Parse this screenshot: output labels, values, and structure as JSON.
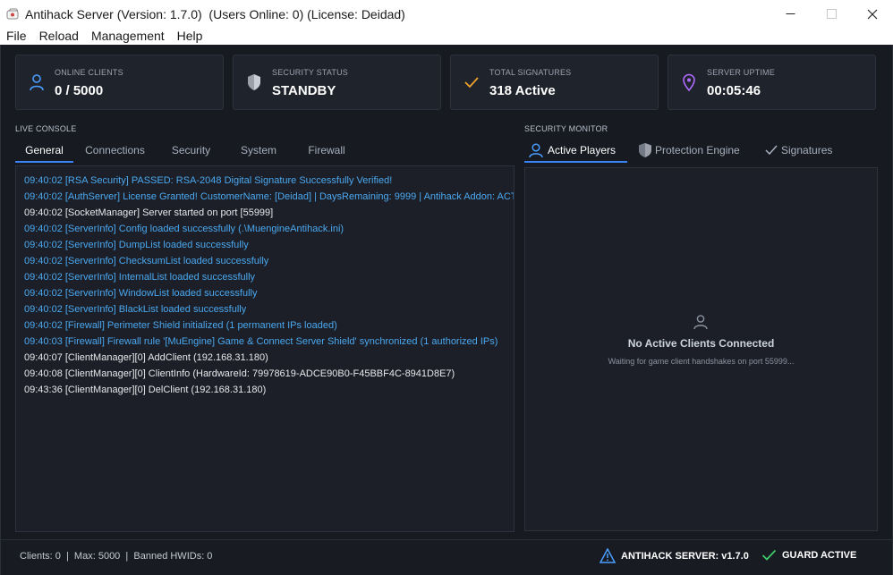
{
  "window": {
    "title": "Antihack Server (Version: 1.7.0)  (Users Online: 0) (License: Deidad)",
    "app_icon": "app-icon",
    "controls": [
      "minimize-icon",
      "maximize-icon",
      "close-icon"
    ]
  },
  "menu": {
    "items": [
      "File",
      "Reload",
      "Management",
      "Help"
    ]
  },
  "cards": [
    {
      "label": "ONLINE CLIENTS",
      "value": "0 / 5000",
      "icon": "user-icon",
      "color": "#4a9eff"
    },
    {
      "label": "SECURITY STATUS",
      "value": "STANDBY",
      "icon": "shield-icon",
      "color": "#c9ced6"
    },
    {
      "label": "TOTAL SIGNATURES",
      "value": "318 Active",
      "icon": "check-icon",
      "color": "#f0a030"
    },
    {
      "label": "SERVER UPTIME",
      "value": "00:05:46",
      "icon": "location-pin-icon",
      "color": "#b06cff"
    }
  ],
  "console": {
    "label": "LIVE CONSOLE",
    "tabs": [
      "General",
      "Connections",
      "Security",
      "System",
      "Firewall"
    ],
    "active_tab": "General",
    "lines": [
      {
        "text": "09:40:02 [RSA Security] PASSED: RSA-2048 Digital Signature Successfully Verified!",
        "kind": "info"
      },
      {
        "text": "09:40:02 [AuthServer] License Granted! CustomerName: [Deidad] | DaysRemaining: 9999 | Antihack Addon: ACT",
        "kind": "info"
      },
      {
        "text": "09:40:02 [SocketManager] Server started on port [55999]",
        "kind": "plain"
      },
      {
        "text": "09:40:02 [ServerInfo] Config loaded successfully (.\\MuengineAntihack.ini)",
        "kind": "info"
      },
      {
        "text": "09:40:02 [ServerInfo] DumpList loaded successfully",
        "kind": "info"
      },
      {
        "text": "09:40:02 [ServerInfo] ChecksumList loaded successfully",
        "kind": "info"
      },
      {
        "text": "09:40:02 [ServerInfo] InternalList loaded successfully",
        "kind": "info"
      },
      {
        "text": "09:40:02 [ServerInfo] WindowList loaded successfully",
        "kind": "info"
      },
      {
        "text": "09:40:02 [ServerInfo] BlackList loaded successfully",
        "kind": "info"
      },
      {
        "text": "09:40:02 [Firewall] Perimeter Shield initialized (1 permanent IPs loaded)",
        "kind": "info"
      },
      {
        "text": "09:40:03 [Firewall] Firewall rule '[MuEngine] Game & Connect Server Shield' synchronized (1 authorized IPs)",
        "kind": "info"
      },
      {
        "text": "09:40:07 [ClientManager][0] AddClient (192.168.31.180)",
        "kind": "plain"
      },
      {
        "text": "09:40:08 [ClientManager][0] ClientInfo (HardwareId: 79978619-ADCE90B0-F45BBF4C-8941D8E7)",
        "kind": "plain"
      },
      {
        "text": "09:43:36 [ClientManager][0] DelClient (192.168.31.180)",
        "kind": "plain"
      }
    ],
    "colors": {
      "info": "#4aa8f0",
      "plain": "#e6e8ec"
    }
  },
  "monitor": {
    "label": "SECURITY MONITOR",
    "tabs": [
      {
        "label": "Active Players",
        "icon": "user-icon"
      },
      {
        "label": "Protection Engine",
        "icon": "shield-icon"
      },
      {
        "label": "Signatures",
        "icon": "check-icon"
      }
    ],
    "active_tab": "Active Players",
    "empty_title": "No Active Clients Connected",
    "empty_subtitle": "Waiting for game client handshakes on port 55999..."
  },
  "status": {
    "left": "Clients: 0  |  Max: 5000  |  Banned HWIDs: 0",
    "server": "ANTIHACK SERVER: v1.7.0",
    "guard": "GUARD ACTIVE",
    "accent": "#3b82f6",
    "guard_color": "#3ecf6a"
  }
}
